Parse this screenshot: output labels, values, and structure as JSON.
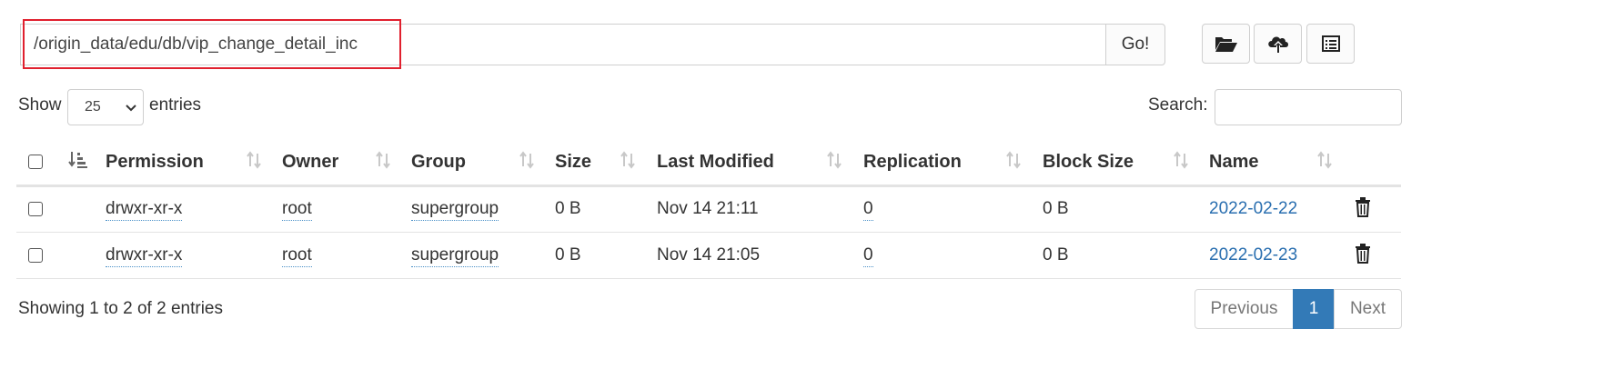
{
  "path_bar": {
    "value": "/origin_data/edu/db/vip_change_detail_inc",
    "go_label": "Go!"
  },
  "toolbar_icons": [
    "folder-open-icon",
    "cloud-upload-icon",
    "list-alt-icon"
  ],
  "controls": {
    "show_label": "Show",
    "entries_value": "25",
    "entries_label": "entries",
    "search_label": "Search:",
    "search_value": ""
  },
  "table": {
    "columns": [
      "Permission",
      "Owner",
      "Group",
      "Size",
      "Last Modified",
      "Replication",
      "Block Size",
      "Name"
    ],
    "rows": [
      {
        "permission": "drwxr-xr-x",
        "owner": "root",
        "group": "supergroup",
        "size": "0 B",
        "modified": "Nov 14 21:11",
        "replication": "0",
        "block_size": "0 B",
        "name": "2022-02-22"
      },
      {
        "permission": "drwxr-xr-x",
        "owner": "root",
        "group": "supergroup",
        "size": "0 B",
        "modified": "Nov 14 21:05",
        "replication": "0",
        "block_size": "0 B",
        "name": "2022-02-23"
      }
    ]
  },
  "footer": {
    "info": "Showing 1 to 2 of 2 entries",
    "previous_label": "Previous",
    "current_page": "1",
    "next_label": "Next"
  },
  "colors": {
    "highlight_border": "#e0202e",
    "link": "#2a6fb0",
    "active_page_bg": "#337ab7"
  }
}
